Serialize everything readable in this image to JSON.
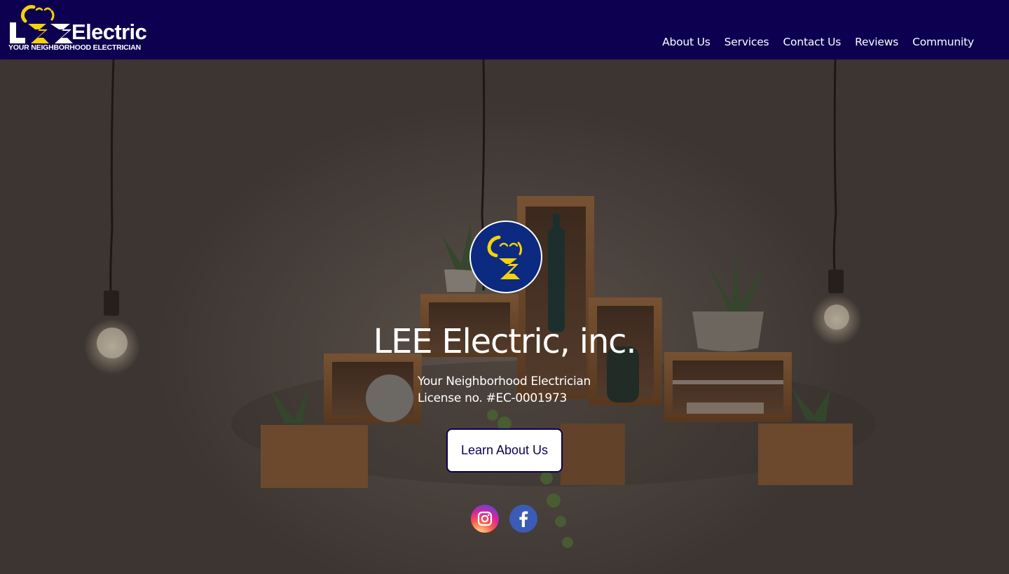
{
  "brand": {
    "wordmark": "Electric",
    "tagline": "YOUR NEIGHBORHOOD ELECTRICIAN"
  },
  "nav": {
    "items": [
      {
        "label": "About Us"
      },
      {
        "label": "Services"
      },
      {
        "label": "Contact Us"
      },
      {
        "label": "Reviews"
      },
      {
        "label": "Community"
      }
    ]
  },
  "hero": {
    "title": "LEE Electric, inc.",
    "subtitle": "Your Neighborhood Electrician",
    "license": "License no. #EC-0001973",
    "cta_label": "Learn About Us"
  },
  "social": [
    {
      "name": "instagram-icon"
    },
    {
      "name": "facebook-icon"
    }
  ],
  "colors": {
    "header_bg": "#0d0050",
    "logo_yellow": "#f5d20a",
    "badge_blue": "#0b2a80",
    "text_white": "#ffffff"
  }
}
